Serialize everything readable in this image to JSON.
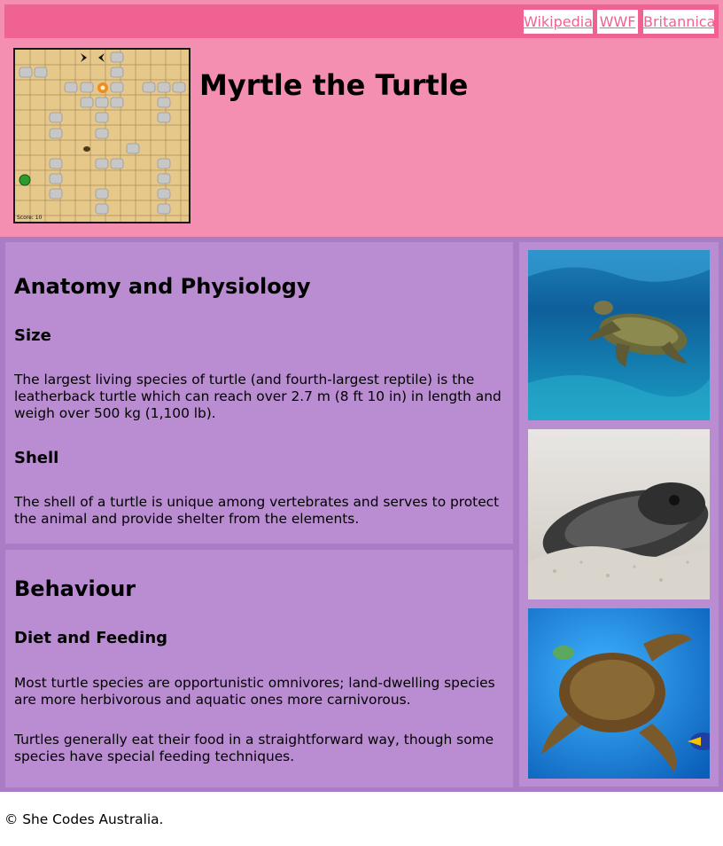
{
  "nav": {
    "links": [
      "Wikipedia",
      "WWF",
      "Britannica"
    ]
  },
  "header": {
    "title": "Myrtle the Turtle",
    "game_score": "Score: 10"
  },
  "sections": {
    "anatomy": {
      "heading": "Anatomy and Physiology",
      "size_heading": "Size",
      "size_text": "The largest living species of turtle (and fourth-largest reptile) is the leatherback turtle which can reach over 2.7 m (8 ft 10 in) in length and weigh over 500 kg (1,100 lb).",
      "shell_heading": "Shell",
      "shell_text": "The shell of a turtle is unique among vertebrates and serves to protect the animal and provide shelter from the elements."
    },
    "behaviour": {
      "heading": "Behaviour",
      "diet_heading": "Diet and Feeding",
      "diet_text_1": "Most turtle species are opportunistic omnivores; land-dwelling species are more herbivorous and aquatic ones more carnivorous.",
      "diet_text_2": "Turtles generally eat their food in a straightforward way, though some species have special feeding techniques."
    }
  },
  "footer": {
    "copyright": "© She Codes Australia."
  },
  "colors": {
    "topbar": "#f06292",
    "header_bg": "#f48fb1",
    "content_bg": "#ab7cc6",
    "panel_bg": "#ba8cd2"
  }
}
